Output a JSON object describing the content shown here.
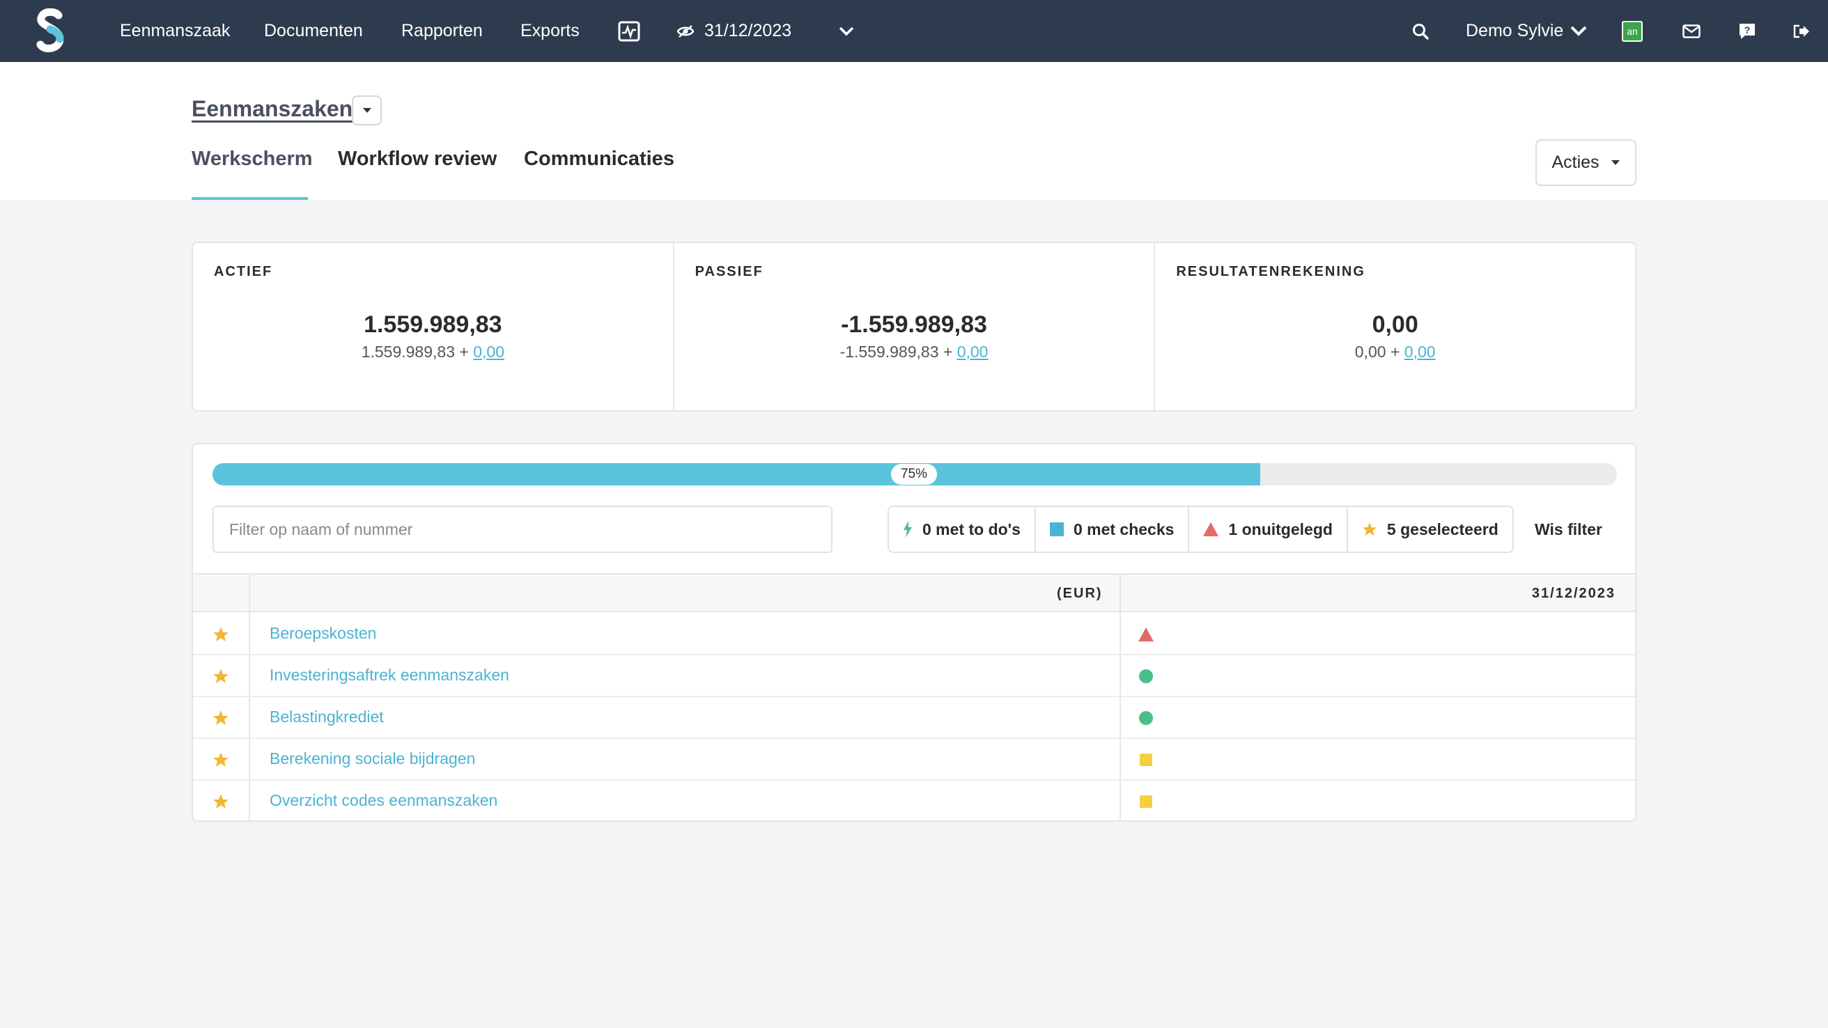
{
  "topbar": {
    "logo": "s-logo",
    "nav": [
      "Eenmanszaak",
      "Documenten",
      "Rapporten",
      "Exports"
    ],
    "monitor_icon": "chart-monitor-icon",
    "period": "31/12/2023",
    "user": "Demo Sylvie",
    "app_badge": "an",
    "colors": {
      "bar": "#2e3a4e",
      "badge": "#3aa549"
    }
  },
  "header": {
    "breadcrumb": "Eenmanszaken",
    "tabs": [
      "Werkscherm",
      "Workflow review",
      "Communicaties"
    ],
    "active_tab": "Werkscherm",
    "actions_label": "Acties"
  },
  "summary": [
    {
      "title": "ACTIEF",
      "value": "1.559.989,83",
      "base": "1.559.989,83 + ",
      "delta": "0,00"
    },
    {
      "title": "PASSIEF",
      "value": "-1.559.989,83",
      "base": "-1.559.989,83 + ",
      "delta": "0,00"
    },
    {
      "title": "RESULTATENREKENING",
      "value": "0,00",
      "base": "0,00 + ",
      "delta": "0,00"
    }
  ],
  "progress": {
    "percent": 75,
    "label": "75%"
  },
  "filter": {
    "placeholder": "Filter op naam of nummer",
    "chips": [
      {
        "label": "0 met to do's",
        "icon": "bolt-icon"
      },
      {
        "label": "0 met checks",
        "icon": "square-icon"
      },
      {
        "label": "1 onuitgelegd",
        "icon": "triangle-icon"
      },
      {
        "label": "5 geselecteerd",
        "icon": "star-icon"
      }
    ],
    "clear_label": "Wis filter"
  },
  "table": {
    "col_currency": "(EUR)",
    "col_date": "31/12/2023",
    "rows": [
      {
        "name": "Beroepskosten",
        "status": "triangle"
      },
      {
        "name": "Investeringsaftrek eenmanszaken",
        "status": "circle"
      },
      {
        "name": "Belastingkrediet",
        "status": "circle"
      },
      {
        "name": "Berekening sociale bijdragen",
        "status": "square"
      },
      {
        "name": "Overzicht codes eenmanszaken",
        "status": "square"
      }
    ],
    "colors": {
      "star": "#f2b632",
      "triangle": "#e46a6a",
      "circle": "#4bbf8a",
      "square": "#f4d03f",
      "link": "#4bb3d2"
    }
  }
}
